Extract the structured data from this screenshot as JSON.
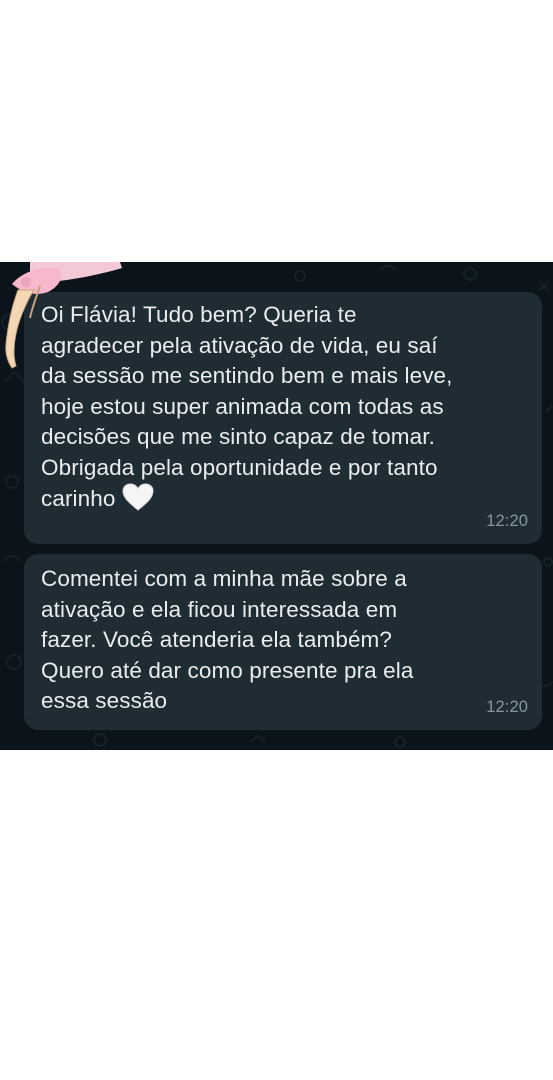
{
  "chat": {
    "messages": [
      {
        "text": "Oi Flávia! Tudo bem? Queria te\nagradecer pela ativação de vida, eu saí\nda sessão me sentindo bem e mais leve,\nhoje estou super animada com todas as\ndecisões que me sinto capaz de tomar.\nObrigada pela oportunidade e por tanto\ncarinho",
        "emoji": "white-heart-icon",
        "time": "12:20"
      },
      {
        "text": "Comentei com a minha mãe sobre a\nativação e ela ficou interessada em\nfazer. Você atenderia ela também?\nQuero até dar como presente pra ela\nessa sessão",
        "time": "12:20"
      }
    ]
  },
  "colors": {
    "chat_background": "#0b141a",
    "bubble_background": "#1f2c34",
    "message_text": "#e9edef",
    "timestamp_text": "#8696a0",
    "page_background": "#ffffff"
  }
}
